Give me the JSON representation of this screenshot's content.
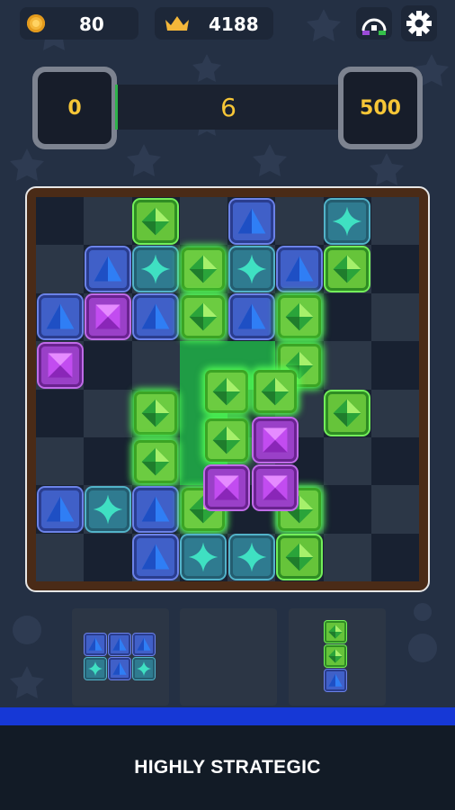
{
  "topbar": {
    "coins": "80",
    "best_score": "4188",
    "icons": [
      "coin-icon",
      "crown-icon",
      "speed-meter-icon",
      "gear-icon"
    ]
  },
  "progress": {
    "current": "0",
    "score": "6",
    "target": "500",
    "fraction": 0.012
  },
  "colors": {
    "background": "#243044",
    "accent": "#f7c637",
    "progress": "#2db14a",
    "footer_strip": "#1638d6"
  },
  "board": {
    "rows": 8,
    "cols": 8,
    "gems": [
      {
        "r": 0,
        "c": 2,
        "t": "green"
      },
      {
        "r": 0,
        "c": 4,
        "t": "blue"
      },
      {
        "r": 0,
        "c": 6,
        "t": "teal"
      },
      {
        "r": 1,
        "c": 1,
        "t": "blue"
      },
      {
        "r": 1,
        "c": 2,
        "t": "teal"
      },
      {
        "r": 1,
        "c": 3,
        "t": "green",
        "hl": true
      },
      {
        "r": 1,
        "c": 4,
        "t": "teal"
      },
      {
        "r": 1,
        "c": 5,
        "t": "blue"
      },
      {
        "r": 1,
        "c": 6,
        "t": "green"
      },
      {
        "r": 2,
        "c": 0,
        "t": "blue"
      },
      {
        "r": 2,
        "c": 1,
        "t": "purple"
      },
      {
        "r": 2,
        "c": 2,
        "t": "blue"
      },
      {
        "r": 2,
        "c": 3,
        "t": "green",
        "hl": true
      },
      {
        "r": 2,
        "c": 4,
        "t": "blue"
      },
      {
        "r": 2,
        "c": 5,
        "t": "green",
        "hl": true
      },
      {
        "r": 3,
        "c": 0,
        "t": "purple"
      },
      {
        "r": 3,
        "c": 5,
        "t": "green",
        "hl": true
      },
      {
        "r": 4,
        "c": 2,
        "t": "green",
        "hl": true
      },
      {
        "r": 4,
        "c": 6,
        "t": "green"
      },
      {
        "r": 5,
        "c": 2,
        "t": "green",
        "hl": true
      },
      {
        "r": 6,
        "c": 0,
        "t": "blue"
      },
      {
        "r": 6,
        "c": 1,
        "t": "teal"
      },
      {
        "r": 6,
        "c": 2,
        "t": "blue"
      },
      {
        "r": 6,
        "c": 3,
        "t": "green",
        "hl": true
      },
      {
        "r": 6,
        "c": 5,
        "t": "green",
        "hl": true
      },
      {
        "r": 7,
        "c": 2,
        "t": "blue"
      },
      {
        "r": 7,
        "c": 3,
        "t": "teal"
      },
      {
        "r": 7,
        "c": 4,
        "t": "teal"
      },
      {
        "r": 7,
        "c": 5,
        "t": "green"
      }
    ],
    "ghost_cells": [
      {
        "r": 3,
        "c": 3
      },
      {
        "r": 3,
        "c": 4
      },
      {
        "r": 4,
        "c": 3
      },
      {
        "r": 5,
        "c": 3
      }
    ],
    "dragged_piece": [
      {
        "r": 0,
        "c": 0,
        "t": "green"
      },
      {
        "r": 0,
        "c": 1,
        "t": "green"
      },
      {
        "r": 1,
        "c": 0,
        "t": "green"
      },
      {
        "r": 1,
        "c": 1,
        "t": "purple"
      },
      {
        "r": 2,
        "c": 0,
        "t": "purple"
      },
      {
        "r": 2,
        "c": 1,
        "t": "purple"
      }
    ]
  },
  "tray": {
    "piece1": [
      {
        "r": 0,
        "c": 0,
        "t": "blue"
      },
      {
        "r": 0,
        "c": 1,
        "t": "blue"
      },
      {
        "r": 0,
        "c": 2,
        "t": "blue"
      },
      {
        "r": 1,
        "c": 0,
        "t": "teal"
      },
      {
        "r": 1,
        "c": 1,
        "t": "blue"
      },
      {
        "r": 1,
        "c": 2,
        "t": "teal"
      }
    ],
    "piece3": [
      {
        "r": 0,
        "c": 0,
        "t": "green"
      },
      {
        "r": 1,
        "c": 0,
        "t": "green"
      },
      {
        "r": 2,
        "c": 0,
        "t": "blue"
      }
    ]
  },
  "footer": {
    "tagline": "HIGHLY STRATEGIC"
  }
}
